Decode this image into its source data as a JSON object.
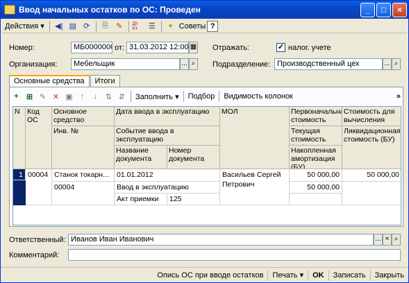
{
  "window": {
    "title": "Ввод начальных остатков по ОС: Проведен"
  },
  "toolbar": {
    "actions_label": "Действия",
    "advice_label": "Советы",
    "help_label": "?",
    "dtkt_label": "Дт Кт"
  },
  "form": {
    "number_label": "Номер:",
    "number_value": "МБ0000000",
    "from_label": "от:",
    "date_value": "31.03.2012 12:00",
    "reflect_label": "Отражать:",
    "tax_check_label": "налог. учете",
    "org_label": "Организация:",
    "org_value": "Мебельщик",
    "division_label": "Подразделение:",
    "division_value": "Производственный цех",
    "responsible_label": "Ответственный:",
    "responsible_value": "Иванов Иван Иванович",
    "comment_label": "Комментарий:",
    "comment_value": ""
  },
  "tabs": [
    {
      "label": "Основные средства"
    },
    {
      "label": "Итоги"
    }
  ],
  "inner_toolbar": {
    "fill_label": "Заполнить",
    "select_label": "Подбор",
    "columns_label": "Видимость колонок",
    "more_label": "»"
  },
  "grid": {
    "headers": {
      "n": "N",
      "code": "Код ОС",
      "asset": "Основное средство",
      "inv": "Инв. №",
      "date_in": "Дата ввода в эксплуатацию",
      "event": "Событие ввода в эксплуатацию",
      "doc_name": "Название документа",
      "doc_num": "Номер документа",
      "mol": "МОЛ",
      "initial_cost": "Первоначальная стоимость (БУ)",
      "current_cost": "Текущая стоимость (БУ)",
      "accum_amort": "Накопленная амортизация (БУ)",
      "cost_for": "Стоимость для вычисления амортизации",
      "liquid_cost": "Ликвидационная стоимость (БУ)"
    },
    "rows": [
      {
        "n": "1",
        "code": "00004",
        "asset": "Станок токарн...",
        "inv": "00004",
        "date_in": "01.01.2012",
        "event": "Ввод в эксплуатацию",
        "doc_name": "Акт приемки",
        "doc_num": "125",
        "mol": "Васильев Сергей Петрович",
        "initial_cost": "50 000,00",
        "current_cost": "50 000,00",
        "cost_for": "50 000,00"
      }
    ]
  },
  "bottom": {
    "opis_label": "Опись ОС при вводе остатков",
    "print_label": "Печать",
    "ok_label": "OK",
    "save_label": "Записать",
    "close_label": "Закрыть"
  },
  "colors": {
    "title_bar": "#0a5fe0",
    "selection": "#0a246a",
    "tab_accent": "#f9a30c"
  }
}
